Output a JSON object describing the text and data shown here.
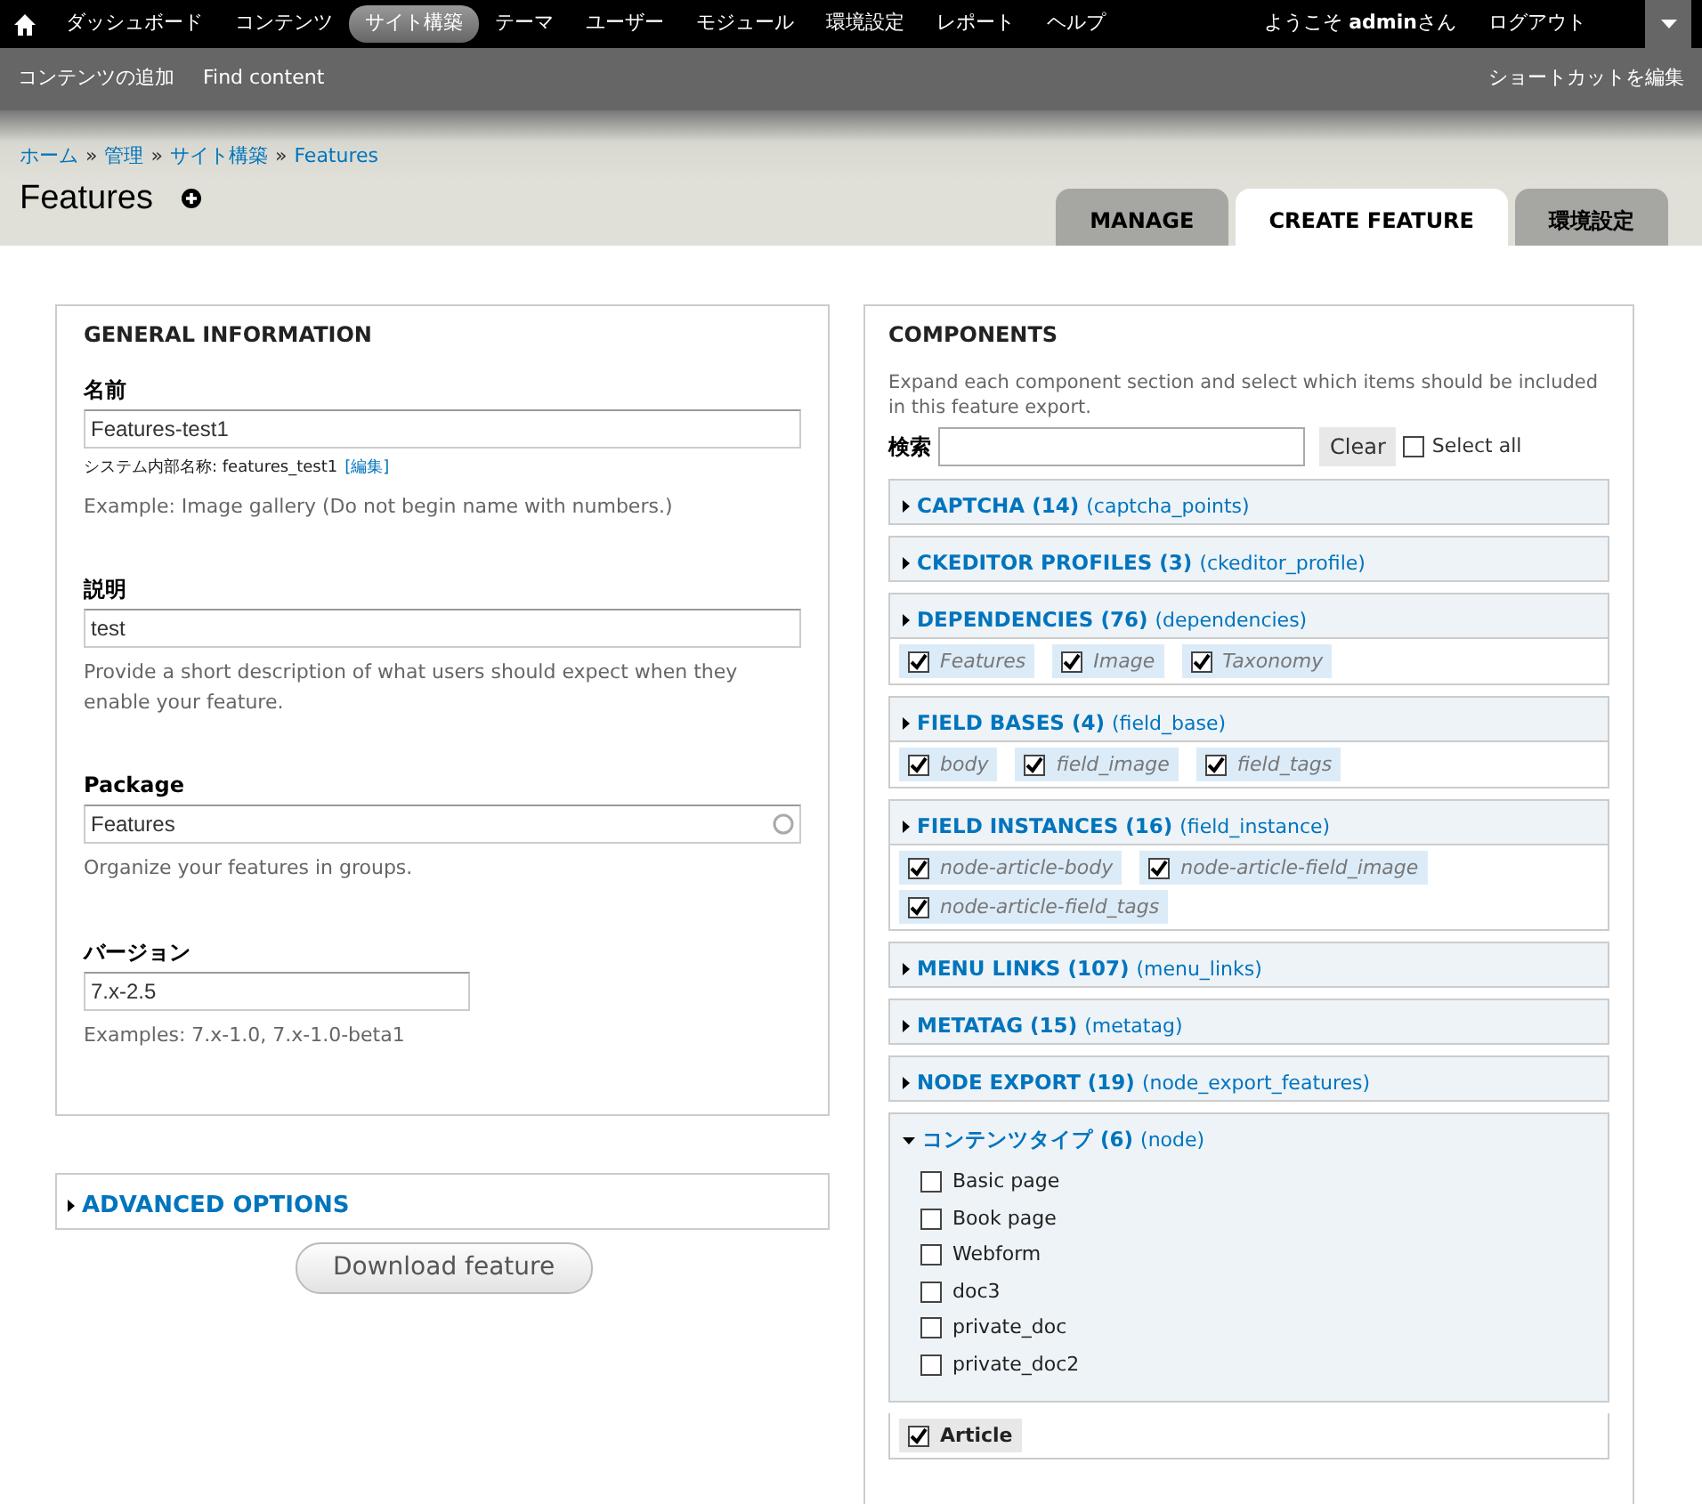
{
  "toolbar": {
    "menu": [
      {
        "label": "ダッシュボード",
        "selected": false
      },
      {
        "label": "コンテンツ",
        "selected": false
      },
      {
        "label": "サイト構築",
        "selected": true
      },
      {
        "label": "テーマ",
        "selected": false
      },
      {
        "label": "ユーザー",
        "selected": false
      },
      {
        "label": "モジュール",
        "selected": false
      },
      {
        "label": "環境設定",
        "selected": false
      },
      {
        "label": "レポート",
        "selected": false
      },
      {
        "label": "ヘルプ",
        "selected": false
      }
    ],
    "welcome": "ようこそ **admin**さん",
    "logout": "ログアウト"
  },
  "shortcuts": {
    "items": [
      "コンテンツの追加",
      "Find content"
    ],
    "edit": "ショートカットを編集"
  },
  "breadcrumb": {
    "items": [
      "ホーム",
      "管理",
      "サイト構築",
      "Features"
    ],
    "separator": "»"
  },
  "title": "Features",
  "tabs": [
    {
      "label": "MANAGE",
      "selected": false
    },
    {
      "label": "CREATE FEATURE",
      "selected": true
    },
    {
      "label": "環境設定",
      "selected": false
    }
  ],
  "general": {
    "legend": "GENERAL INFORMATION",
    "fields": [
      {
        "kind": "text",
        "label": "名前",
        "value": "Features-test1",
        "machine_name": "システム内部名称: features_test1",
        "machine_edit": "[編集]",
        "description": "Example: Image gallery (Do not begin name with numbers.)"
      },
      {
        "kind": "text",
        "label": "説明",
        "value": "test",
        "description": "Provide a short description of what users should expect when they enable your feature."
      },
      {
        "kind": "autocomplete",
        "label": "Package",
        "value": "Features",
        "description": "Organize your features in groups."
      },
      {
        "kind": "short",
        "label": "バージョン",
        "value": "7.x-2.5",
        "description": "Examples: 7.x-1.0, 7.x-1.0-beta1"
      }
    ]
  },
  "advanced": {
    "label": "ADVANCED OPTIONS",
    "expanded": false
  },
  "download_button": "Download feature",
  "components": {
    "legend": "COMPONENTS",
    "description": "Expand each component section and select which items should be included in this feature export.",
    "search_label": "検索",
    "clear": "Clear",
    "select_all": {
      "label": "Select all",
      "checked": false
    },
    "sections": [
      {
        "title": "CAPTCHA (14)",
        "machine": "(captcha_points)",
        "expanded": false
      },
      {
        "title": "CKEDITOR PROFILES (3)",
        "machine": "(ckeditor_profile)",
        "expanded": false
      },
      {
        "title": "DEPENDENCIES (76)",
        "machine": "(dependencies)",
        "expanded": false,
        "selected_items": [
          {
            "label": "Features",
            "checked": true,
            "kind": "auto"
          },
          {
            "label": "Image",
            "checked": true,
            "kind": "auto"
          },
          {
            "label": "Taxonomy",
            "checked": true,
            "kind": "auto"
          }
        ]
      },
      {
        "title": "FIELD BASES (4)",
        "machine": "(field_base)",
        "expanded": false,
        "selected_items": [
          {
            "label": "body",
            "checked": true,
            "kind": "auto"
          },
          {
            "label": "field_image",
            "checked": true,
            "kind": "auto"
          },
          {
            "label": "field_tags",
            "checked": true,
            "kind": "auto"
          }
        ]
      },
      {
        "title": "FIELD INSTANCES (16)",
        "machine": "(field_instance)",
        "expanded": false,
        "selected_items": [
          {
            "label": "node-article-body",
            "checked": true,
            "kind": "auto"
          },
          {
            "label": "node-article-field_image",
            "checked": true,
            "kind": "auto"
          },
          {
            "label": "node-article-field_tags",
            "checked": true,
            "kind": "auto"
          }
        ]
      },
      {
        "title": "MENU LINKS (107)",
        "machine": "(menu_links)",
        "expanded": false
      },
      {
        "title": "METATAG (15)",
        "machine": "(metatag)",
        "expanded": false
      },
      {
        "title": "NODE EXPORT (19)",
        "machine": "(node_export_features)",
        "expanded": false
      },
      {
        "title": "コンテンツタイプ (6)",
        "machine": "(node)",
        "expanded": true,
        "options": [
          {
            "label": "Basic page",
            "checked": false
          },
          {
            "label": "Book page",
            "checked": false
          },
          {
            "label": "Webform",
            "checked": false
          },
          {
            "label": "doc3",
            "checked": false
          },
          {
            "label": "private_doc",
            "checked": false
          },
          {
            "label": "private_doc2",
            "checked": false
          }
        ],
        "selected_items": [
          {
            "label": "Article",
            "checked": true,
            "kind": "manual"
          }
        ]
      }
    ]
  }
}
